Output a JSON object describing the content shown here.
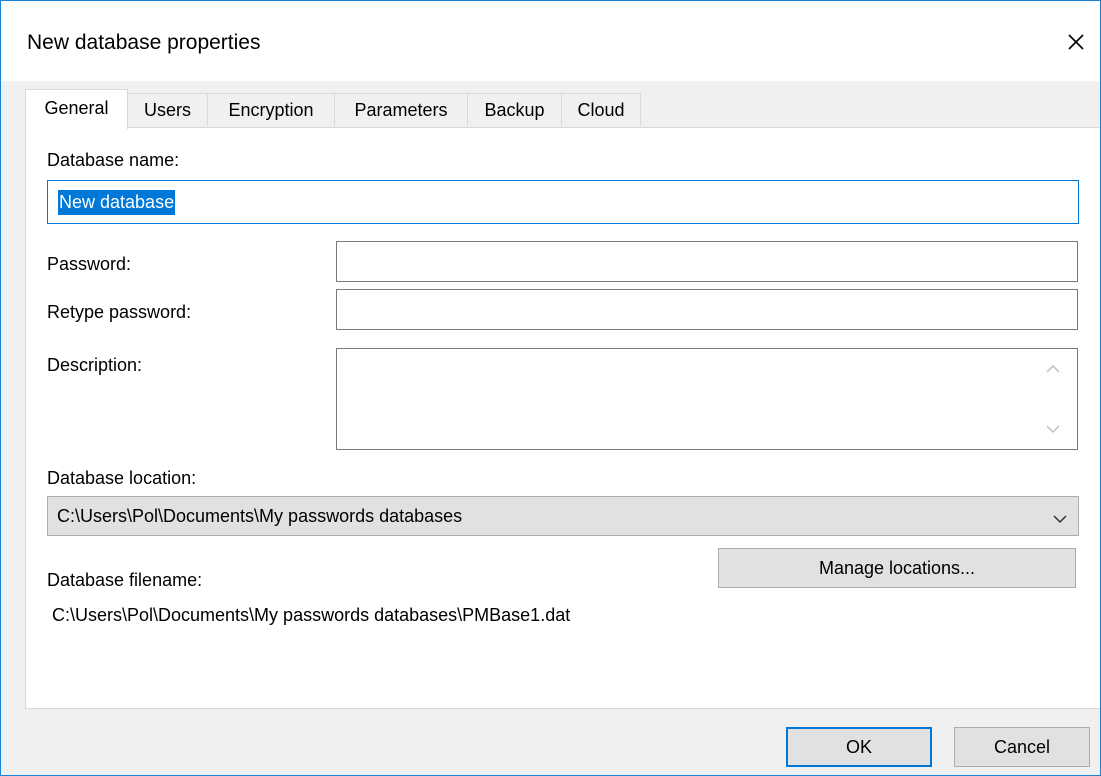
{
  "window": {
    "title": "New database properties"
  },
  "tabs": [
    {
      "label": "General",
      "active": true
    },
    {
      "label": "Users",
      "active": false
    },
    {
      "label": "Encryption",
      "active": false
    },
    {
      "label": "Parameters",
      "active": false
    },
    {
      "label": "Backup",
      "active": false
    },
    {
      "label": "Cloud",
      "active": false
    }
  ],
  "general": {
    "database_name_label": "Database name:",
    "database_name_value": "New database",
    "password_label": "Password:",
    "password_value": "",
    "retype_password_label": "Retype password:",
    "retype_password_value": "",
    "description_label": "Description:",
    "description_value": "",
    "location_label": "Database location:",
    "location_value": "C:\\Users\\Pol\\Documents\\My passwords databases",
    "manage_locations_label": "Manage locations...",
    "filename_label": "Database filename:",
    "filename_value": "C:\\Users\\Pol\\Documents\\My passwords databases\\PMBase1.dat"
  },
  "footer": {
    "ok_label": "OK",
    "cancel_label": "Cancel"
  },
  "icons": {
    "close": "close-icon",
    "scroll_up": "chevron-up-icon",
    "scroll_down": "chevron-down-icon",
    "dropdown": "chevron-down-icon"
  },
  "colors": {
    "accent": "#0078d7",
    "window_border": "#1883d7",
    "dialog_bg": "#f0f0f0",
    "button_bg": "#e1e1e1"
  }
}
